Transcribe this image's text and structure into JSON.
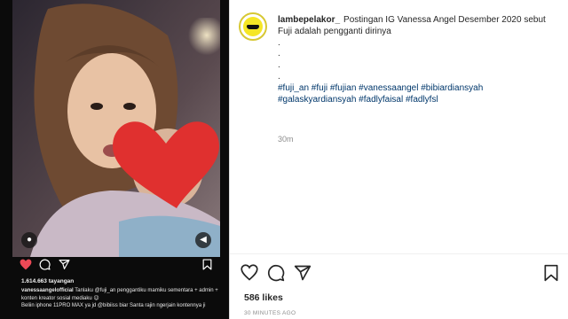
{
  "media": {
    "inner_views": "1.614.663 tayangan",
    "inner_username": "vanessaangelofficial",
    "inner_caption_line1": "Tanlaku @fuji_an penggantiku mamiku sementara + admin +",
    "inner_caption_line2": "konten kreator sosial mediaku 😉",
    "inner_caption_line3": "Beliin iphone 11PRO MAX ya jd @bibiiss biar Santa rajin ngerjain kontennya ji",
    "icons": [
      "info-icon",
      "sound-icon",
      "heart-icon",
      "comment-icon",
      "share-icon",
      "bookmark-icon"
    ],
    "colors": {
      "heart": "#e0302f",
      "background": "#0b0b0b"
    }
  },
  "post": {
    "username": "lambepelakor_",
    "caption": "Postingan IG Vanessa Angel Desember 2020 sebut Fuji adalah pengganti dirinya",
    "dots": [
      ".",
      ".",
      ".",
      "."
    ],
    "hashtags_line1": "#fuji_an #fuji #fujian #vanessaangel #bibiardiansyah",
    "hashtags_line2": "#galaskyardiansyah #fadlyfaisal #fadlyfsl",
    "time": "30m",
    "likes": "586 likes",
    "ago": "30 MINUTES AGO",
    "colors": {
      "hashtag": "#00376b",
      "muted": "#8e8e8e",
      "avatar_ring": "#d7c833"
    }
  }
}
